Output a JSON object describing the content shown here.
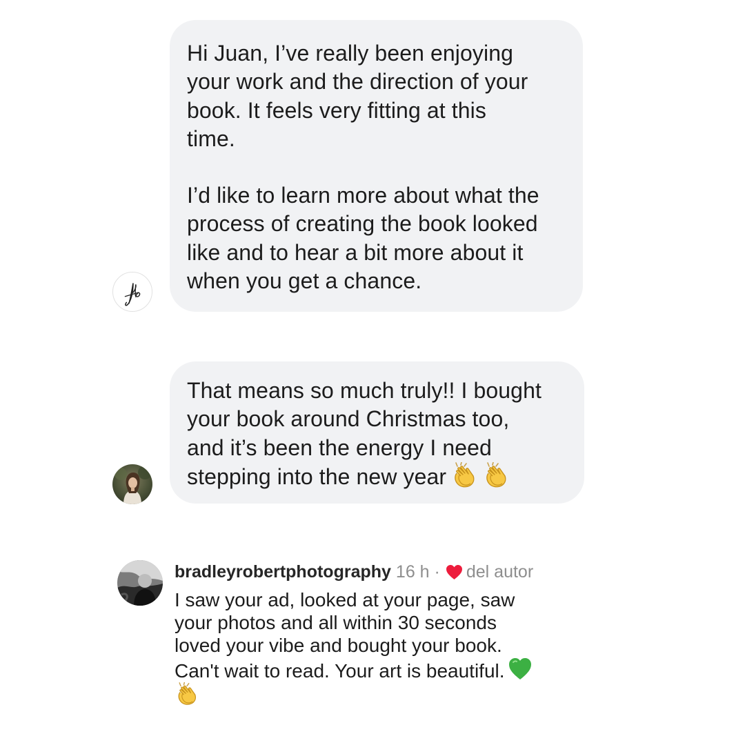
{
  "messages": [
    {
      "paragraphs": [
        [
          "Hi Juan, I’ve really been enjoying",
          "your work and the direction of your",
          "book. It feels very fitting at this",
          "time."
        ],
        [
          "I’d like to learn more about what the",
          "process of creating the book looked",
          "like and to hear a bit more about it",
          "when you get a chance."
        ]
      ]
    },
    {
      "lines": [
        "That means so much truly!! I bought",
        "your book around Christmas too,",
        "and it’s been the energy I need",
        "stepping into the new year"
      ],
      "emojis": [
        "clapping-hands",
        "clapping-hands"
      ]
    }
  ],
  "comment": {
    "username": "bradleyrobertphotography",
    "time": "16 h ·",
    "liked_by": "del autor",
    "lines": [
      "I saw your ad, looked at your page, saw",
      "your photos and all within 30 seconds",
      "loved your vibe and bought your book.",
      "Can't wait to read. Your art is beautiful."
    ],
    "emojis": [
      "green-heart",
      "clapping-hands"
    ]
  },
  "colors": {
    "bubble": "#f1f2f4",
    "heart": "#ed1c3c",
    "green_heart": "#3cb043"
  }
}
